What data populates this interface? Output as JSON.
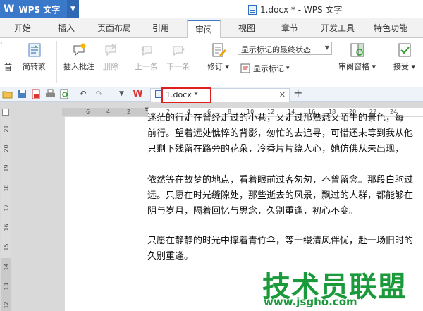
{
  "app": {
    "logo": "W",
    "name": "WPS 文字"
  },
  "title": "1.docx * - WPS 文字",
  "ribbon_tabs": [
    "开始",
    "插入",
    "页面布局",
    "引用",
    "审阅",
    "视图",
    "章节",
    "开发工具",
    "特色功能"
  ],
  "active_tab": "审阅",
  "ribbon": {
    "partial_left_label": "首",
    "simp_trad": "简转繁",
    "insert_comment": "插入批注",
    "delete": "删除",
    "prev": "上一条",
    "next": "下一条",
    "revise": "修订",
    "markup_combo": "显示标记的最终状态",
    "show_markup": "显示标记",
    "review_pane": "审阅窗格",
    "accept": "接受"
  },
  "document_tab": {
    "label": "1.docx *"
  },
  "ruler": {
    "h_marks": [
      "6",
      "4",
      "2",
      "2",
      "4",
      "6",
      "8",
      "10",
      "12",
      "14",
      "16",
      "18",
      "20",
      "22",
      "24"
    ],
    "v_marks": [
      "21",
      "20",
      "19",
      "18",
      "17",
      "16",
      "15",
      "14",
      "13",
      "12"
    ]
  },
  "document": {
    "lines": [
      "迷茫的行走在曾经走过的小巷，又走过那熟悉又陌生的景色，每",
      "前行。望着远处憔悴的背影，匆忙的去追寻，可惜还未等到我从他",
      "只剩下残留在路旁的花朵，冷香片片绕人心，她仿佛从未出现，",
      "",
      "依然等在故梦的地点，看着眼前过客匆匆，不曾留念。那段白驹过",
      "远。只愿在时光缝隙处，那些逝去的风景，飘过的人群，都能够在",
      "阴与岁月，隔着回忆与思念，久别重逢，初心不变。",
      "",
      "只愿在静静的时光中撑着青竹伞，等一缕清风伴忧，赴一场旧时的",
      "久别重逢。"
    ]
  },
  "watermark": {
    "text": "技术员联盟",
    "url": "www.jsgho.com"
  },
  "colors": {
    "accent": "#3a78c9",
    "highlight": "#e02020",
    "watermark": "#1a9a3a"
  }
}
